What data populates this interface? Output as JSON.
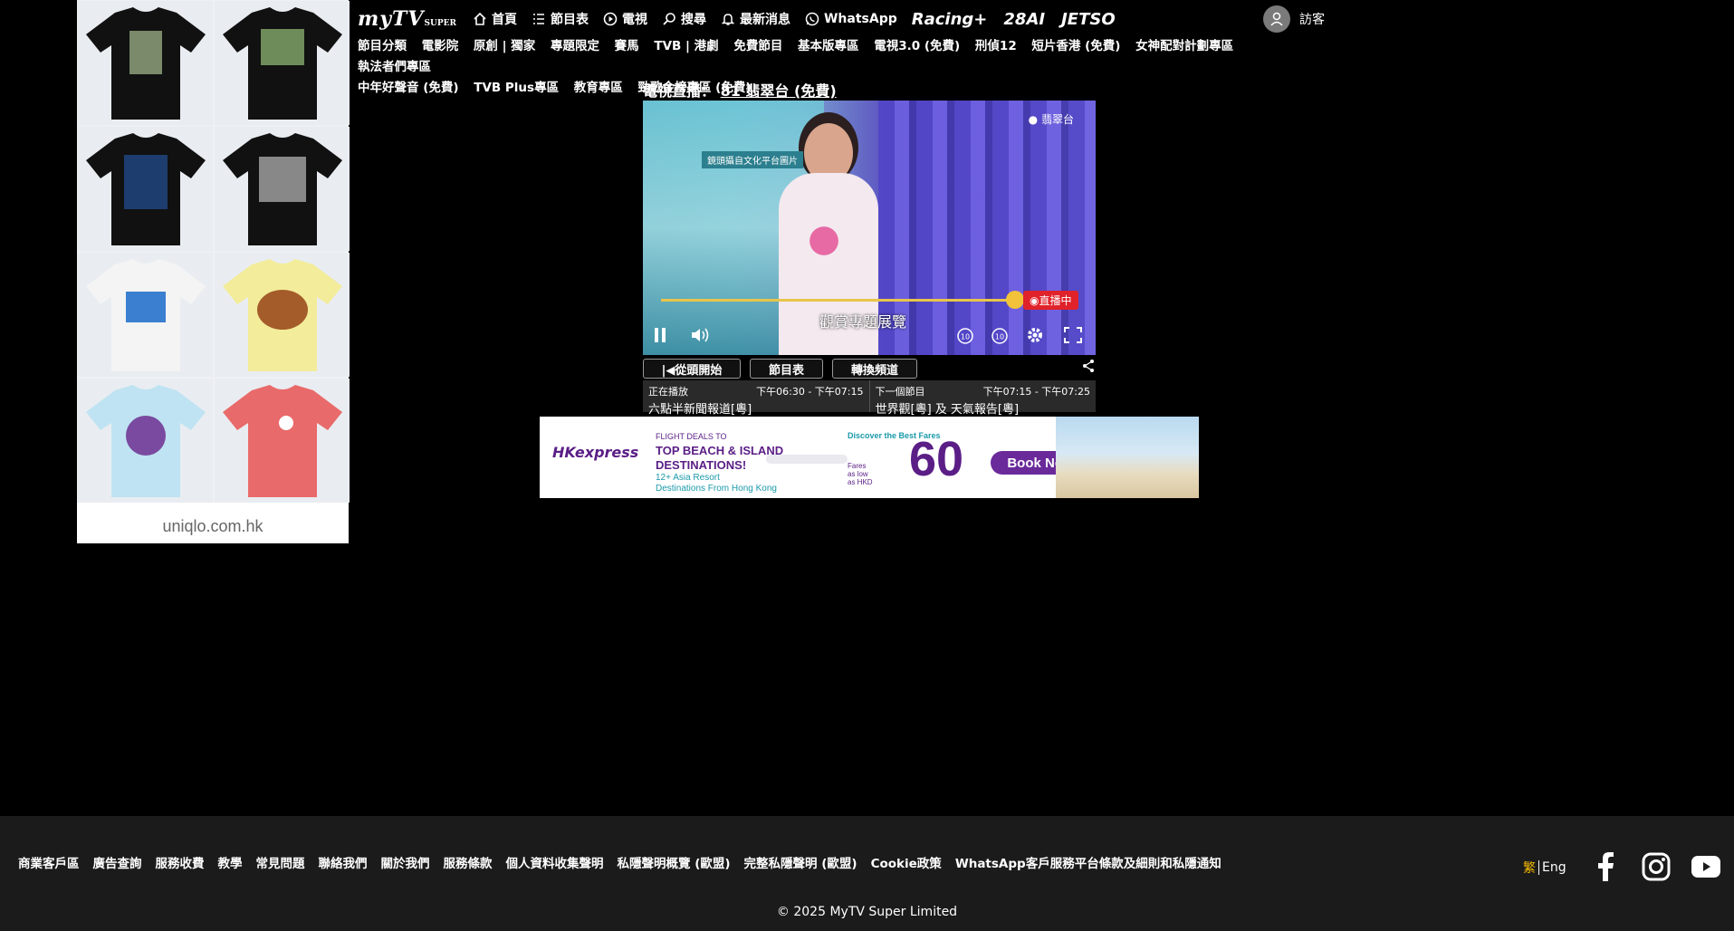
{
  "left_ad": {
    "domain": "uniqlo.com.hk",
    "products": [
      "black-tee-graphic",
      "black-tee-graphic",
      "black-tee-text",
      "black-tee-mountain",
      "white-tee-print",
      "yellow-tee-print",
      "light-blue-tee-print",
      "red-tee-print"
    ]
  },
  "header": {
    "logo_main": "myTV",
    "logo_sub": "SUPER",
    "nav": [
      {
        "label": "首頁",
        "icon": "home-icon"
      },
      {
        "label": "節目表",
        "icon": "list-icon"
      },
      {
        "label": "電視",
        "icon": "play-circle-icon"
      },
      {
        "label": "搜尋",
        "icon": "search-icon"
      },
      {
        "label": "最新消息",
        "icon": "bell-icon"
      },
      {
        "label": "WhatsApp",
        "icon": "whatsapp-icon"
      }
    ],
    "brands": [
      "Racing+",
      "28AI",
      "JETSO"
    ],
    "user_label": "訪客"
  },
  "categories": [
    "節目分類",
    "電影院",
    "原創 | 獨家",
    "專題限定",
    "賽馬",
    "TVB | 港劇",
    "免費節目",
    "基本版專區",
    "電視3.0 (免費)",
    "刑偵12",
    "短片香港 (免費)",
    "女神配對計劃專區",
    "執法者們專區",
    "中年好聲音 (免費)",
    "TVB Plus專區",
    "教育專區",
    "勁歌金榜專區 (免費)"
  ],
  "player": {
    "heading_label": "電視直播：",
    "channel": "81 翡翠台 (免費)",
    "watermark": "翡翠台",
    "onscreen_caption": "鏡頭攝自文化平台圖片",
    "subtitle": "觀賞專題展覽",
    "live_badge": "直播中",
    "progress": 1.0
  },
  "player_buttons": {
    "restart": "|◀從頭開始",
    "schedule": "節目表",
    "switch": "轉換頻道"
  },
  "schedule": {
    "now_label": "正在播放",
    "now_time": "下午06:30 - 下午07:15",
    "now_program": "六點半新聞報道[粵]",
    "next_label": "下一個節目",
    "next_time": "下午07:15 - 下午07:25",
    "next_program": "世界觀[粵] 及 天氣報告[粵]"
  },
  "banner_ad": {
    "brand": "HKexpress",
    "line1": "FLIGHT DEALS TO",
    "line2": "TOP BEACH & ISLAND",
    "line3": "DESTINATIONS!",
    "line4": "12+ Asia Resort",
    "line5": "Destinations From Hong Kong",
    "tagline": "Discover the Best Fares",
    "price_prefix": "Fares as low as HKD",
    "price": "60",
    "cta": "Book Now"
  },
  "footer": {
    "links": [
      "商業客戶區",
      "廣告查詢",
      "服務收費",
      "教學",
      "常見問題",
      "聯絡我們",
      "關於我們",
      "服務條款",
      "個人資料收集聲明",
      "私隱聲明概覽 (歐盟)",
      "完整私隱聲明 (歐盟)",
      "Cookie政策",
      "WhatsApp客戶服務平台條款及細則和私隱通知"
    ],
    "lang_zh": "繁",
    "lang_en": "Eng",
    "copyright": "© 2025 MyTV Super Limited"
  }
}
